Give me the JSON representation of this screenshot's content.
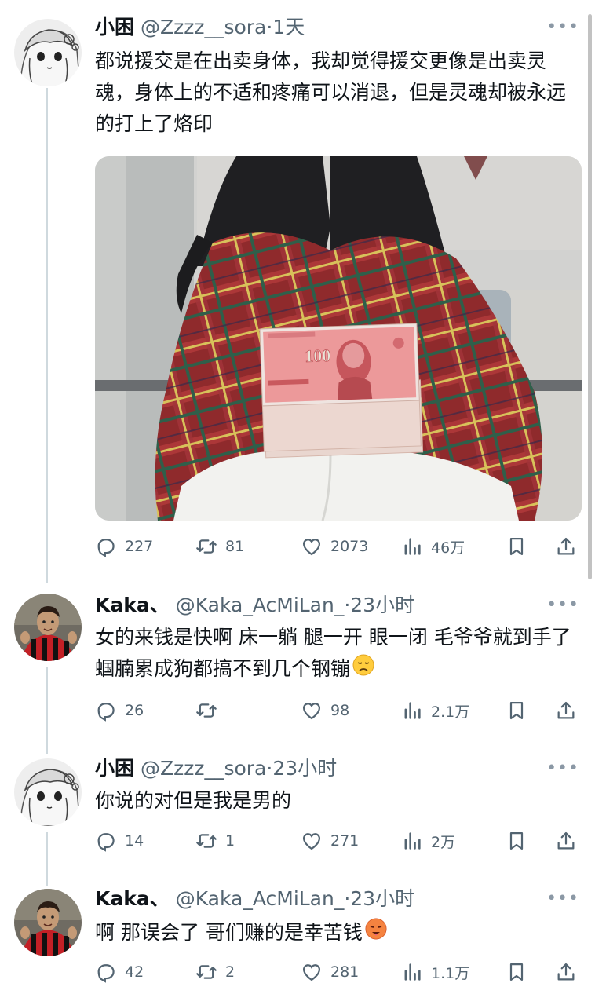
{
  "tweets": [
    {
      "name": "小困",
      "handle": "@Zzzz__sora·1天",
      "text": "都说援交是在出卖身体，我却觉得援交更像是出卖灵魂，身体上的不适和疼痛可以消退，但是灵魂却被永远的打上了烙印",
      "replies": "227",
      "retweets": "81",
      "likes": "2073",
      "views": "46万"
    },
    {
      "name": "Kaka、",
      "handle": "@Kaka_AcMiLan_·23小时",
      "text": "女的来钱是快啊 床一躺 腿一开 眼一闭 毛爷爷就到手了 蝈腩累成狗都搞不到几个钢镚",
      "replies": "26",
      "retweets": "",
      "likes": "98",
      "views": "2.1万"
    },
    {
      "name": "小困",
      "handle": "@Zzzz__sora·23小时",
      "text": "你说的对但是我是男的",
      "replies": "14",
      "retweets": "1",
      "likes": "271",
      "views": "2万"
    },
    {
      "name": "Kaka、",
      "handle": "@Kaka_AcMiLan_·23小时",
      "text": "啊 那误会了 哥们赚的是幸苦钱",
      "replies": "42",
      "retweets": "2",
      "likes": "281",
      "views": "1.1万"
    }
  ],
  "banknote": {
    "denomination": "100"
  },
  "colors": {
    "text": "#0f1419",
    "secondary": "#536471",
    "thread_line": "#cfd9de"
  },
  "icons": [
    "reply-icon",
    "retweet-icon",
    "like-icon",
    "views-icon",
    "bookmark-icon",
    "share-icon",
    "more-icon"
  ]
}
